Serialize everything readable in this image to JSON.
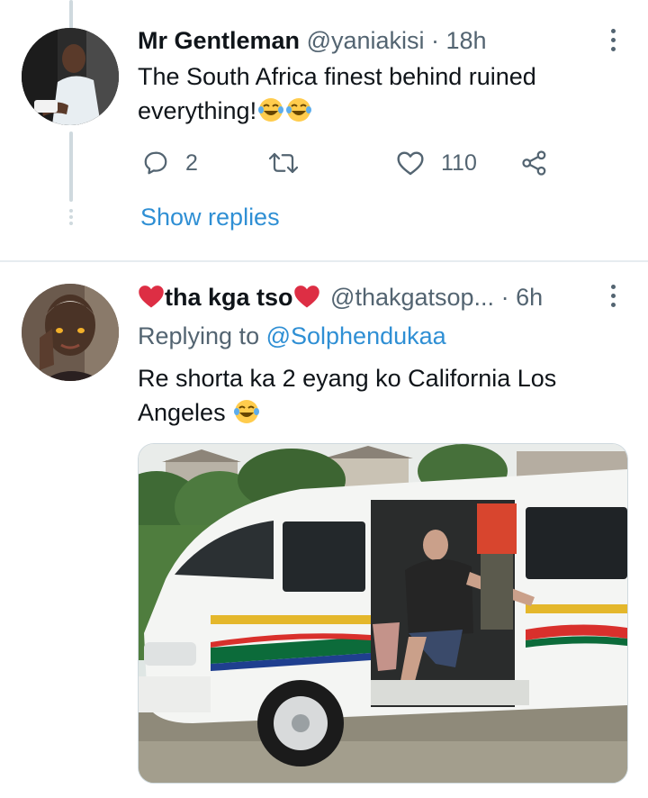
{
  "tweet1": {
    "name": "Mr Gentleman",
    "handle": "@yaniakisi",
    "sep": " · ",
    "time": "18h",
    "text_line1": "The South Africa finest behind ruined",
    "text_line2": "everything!",
    "reply_count": "2",
    "like_count": "110",
    "show_replies": "Show replies"
  },
  "tweet2": {
    "name": "tha kga tso",
    "handle": "@thakgatsop...",
    "sep": " · ",
    "time": "6h",
    "replying_prefix": "Replying to ",
    "replying_to": "@Solphendukaa",
    "text_line1": "Re shorta ka 2 eyang ko California Los",
    "text_line2": "Angeles",
    "media_description": "white minibus taxi with South African flag stripes, man in black t-shirt sitting in open sliding door"
  },
  "icons": {
    "reply": "reply-icon",
    "retweet": "retweet-icon",
    "like": "heart-icon",
    "share": "share-icon",
    "more": "more-vertical-icon",
    "emoji_laugh": "tears-of-joy-emoji",
    "heart_emoji": "red-heart-emoji"
  },
  "colors": {
    "link": "#2f8fd4",
    "secondary": "#536471",
    "heart_red": "#e0245e"
  }
}
